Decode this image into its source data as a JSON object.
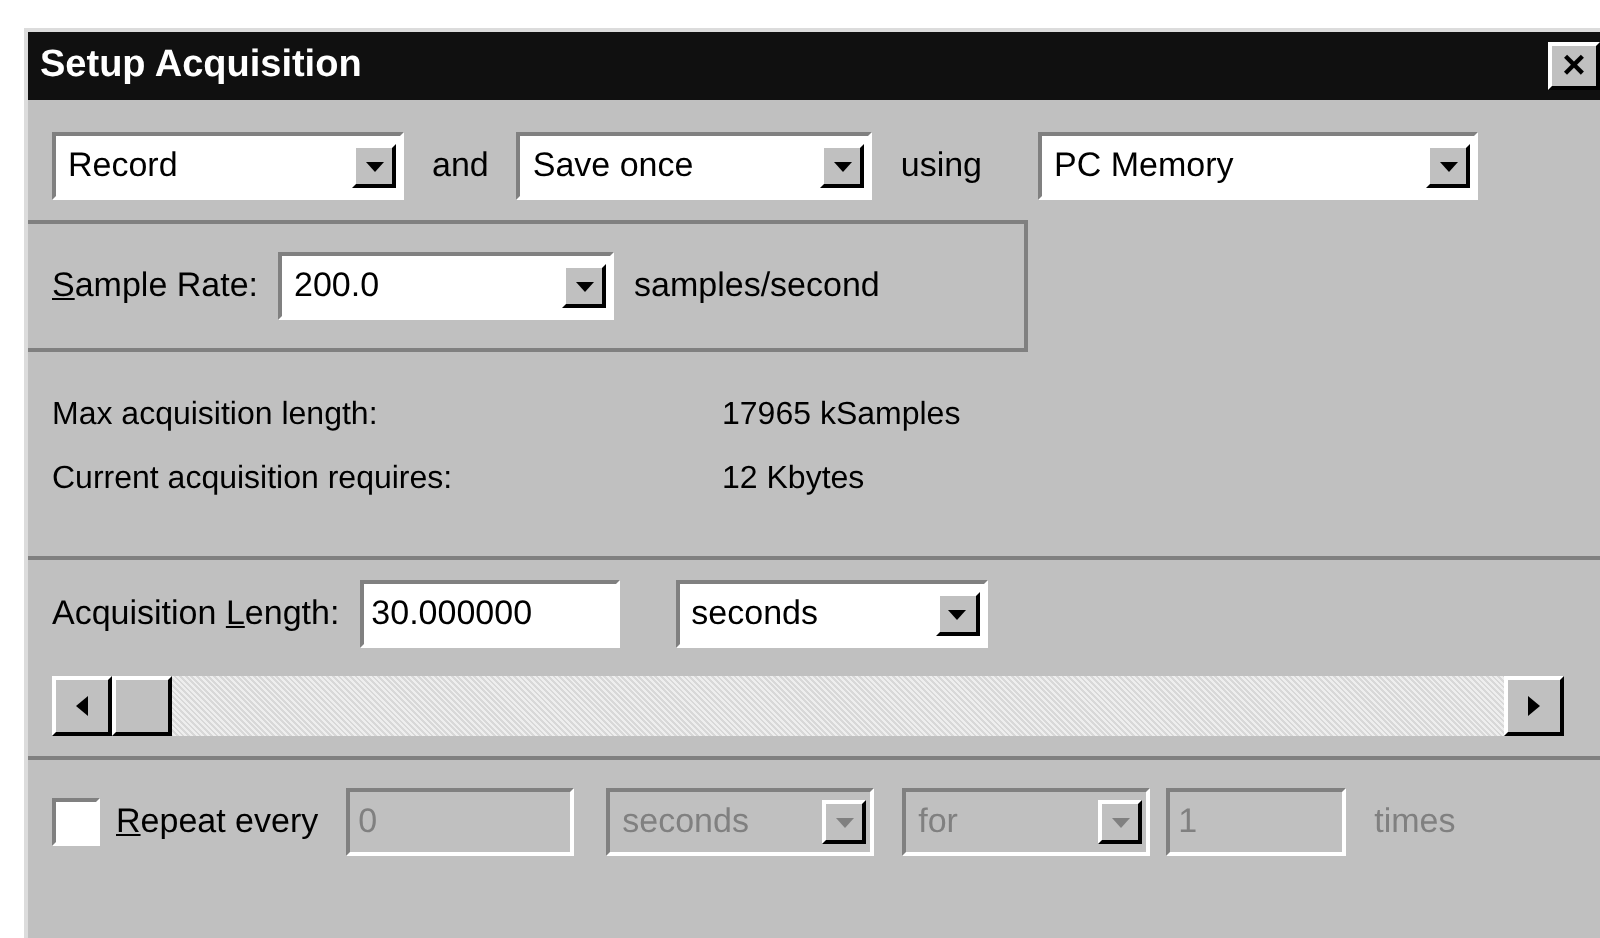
{
  "window": {
    "title": "Setup Acquisition",
    "close": "×"
  },
  "mode_row": [
    {
      "kind": "combo",
      "value": "Record",
      "disabled": false
    },
    {
      "kind": "text",
      "text": "and"
    },
    {
      "kind": "combo",
      "value": "Save once",
      "disabled": false
    },
    {
      "kind": "text",
      "text": "using"
    },
    {
      "kind": "combo",
      "value": "PC Memory",
      "disabled": false
    }
  ],
  "sample_rate": {
    "access_key": "S",
    "label_after": "ample Rate:",
    "value": "200.0",
    "unit": "samples/second"
  },
  "info": [
    {
      "label": "Max acquisition length:",
      "value": "17965 kSamples"
    },
    {
      "label": "Current acquisition requires:",
      "value": "12 Kbytes"
    }
  ],
  "acquisition_length": {
    "label_before": "Acquisition ",
    "access_key": "L",
    "label_after": "ength:",
    "value": "30.000000",
    "unit": "seconds",
    "scrollbar": {
      "level": 0
    }
  },
  "repeat": {
    "checked": false,
    "access_key": "R",
    "label_after": "epeat every",
    "interval": "0",
    "interval_unit": "seconds",
    "mode": "for",
    "count": "1",
    "suffix": "times",
    "disabled": true
  }
}
